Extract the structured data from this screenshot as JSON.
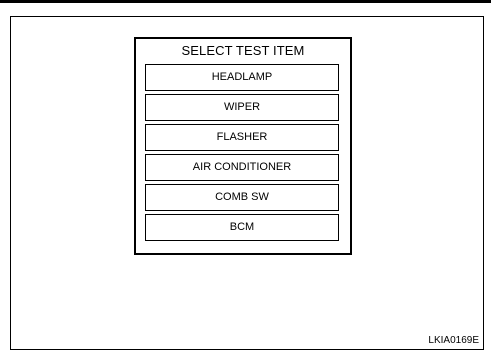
{
  "screen": {
    "title": "SELECT TEST ITEM",
    "items": [
      {
        "label": "HEADLAMP"
      },
      {
        "label": "WIPER"
      },
      {
        "label": "FLASHER"
      },
      {
        "label": "AIR CONDITIONER"
      },
      {
        "label": "COMB SW"
      },
      {
        "label": "BCM"
      }
    ]
  },
  "figure": {
    "code": "LKIA0169E"
  }
}
